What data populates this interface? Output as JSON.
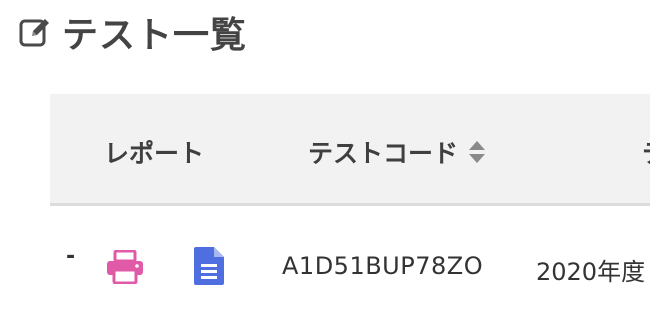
{
  "page": {
    "title": "テスト一覧",
    "title_icon": "edit-icon"
  },
  "table": {
    "columns": [
      {
        "label": "レポート"
      },
      {
        "label": "テストコード",
        "sort_icon": "sort-icon"
      },
      {
        "label": "テ"
      }
    ],
    "rows": [
      {
        "dash": "-",
        "print_icon": "print-icon",
        "print_color": "#e05aa8",
        "report_icon": "document-icon",
        "report_color": "#4f6fe0",
        "code": "A1D51BUP78ZO",
        "date": "2020年度"
      }
    ]
  }
}
